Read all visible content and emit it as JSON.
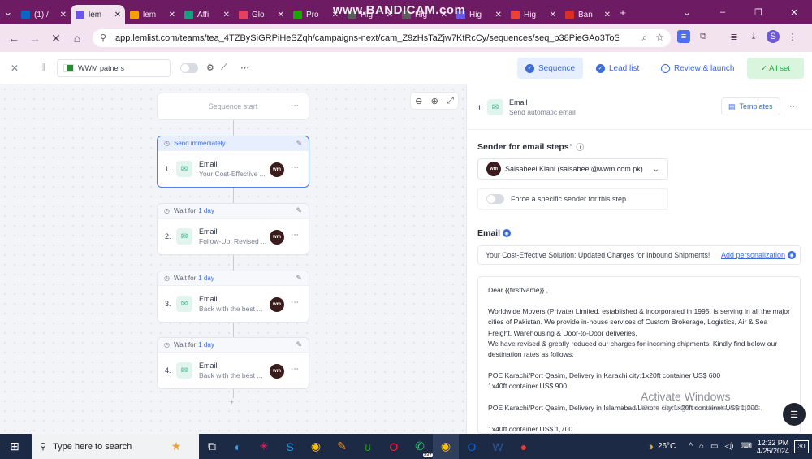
{
  "browser": {
    "tabs": [
      {
        "label": "(1) /",
        "color": "#0a66c2"
      },
      {
        "label": "lem",
        "color": "#6a56e8",
        "active": true
      },
      {
        "label": "lem",
        "color": "#f59e0b"
      },
      {
        "label": "Affi",
        "color": "#10a37f"
      },
      {
        "label": "Glo",
        "color": "#e4405f"
      },
      {
        "label": "Pro",
        "color": "#14a800"
      },
      {
        "label": "Hig",
        "color": "#5c5c5c"
      },
      {
        "label": "Hig",
        "color": "#5c5c5c"
      },
      {
        "label": "Hig",
        "color": "#6a56e8"
      },
      {
        "label": "Hig",
        "color": "#ea4335"
      },
      {
        "label": "Ban",
        "color": "#d93025"
      }
    ],
    "watermark": "www.BANDICAM.com",
    "url": "app.lemlist.com/teams/tea_4TZBySiGRPiHeSZqh/campaigns-next/cam_Z9zHsTaZjw7KtRcCy/sequences/seq_p38PieGAo3ToSMSLT/edit",
    "new_tab": "+"
  },
  "app": {
    "campaign_name": "WWM patners",
    "tabs": {
      "sequence": "Sequence",
      "lead_list": "Lead list",
      "review": "Review & launch"
    },
    "status": "✓ All set"
  },
  "canvas": {
    "start_label": "Sequence start",
    "steps": [
      {
        "num": "1.",
        "delay_prefix": "Send immediately",
        "delay_days": "",
        "type": "Email",
        "preview": "Your Cost-Effective ...",
        "selected": true
      },
      {
        "num": "2.",
        "delay_prefix": "Wait for",
        "delay_days": "1 day",
        "type": "Email",
        "preview": "Follow-Up: Revised ...",
        "selected": false
      },
      {
        "num": "3.",
        "delay_prefix": "Wait for",
        "delay_days": "1 day",
        "type": "Email",
        "preview": "Back with the best ...",
        "selected": false
      },
      {
        "num": "4.",
        "delay_prefix": "Wait for",
        "delay_days": "1 day",
        "type": "Email",
        "preview": "Back with the best ...",
        "selected": false
      }
    ],
    "avatar_text": "wm"
  },
  "panel": {
    "step_num": "1.",
    "step_title": "Email",
    "step_subtitle": "Send automatic email",
    "templates_label": "Templates",
    "sender_label": "Sender for email steps",
    "sender_value": "Salsabeel Kiani (salsabeel@wwm.com.pk)",
    "force_label": "Force a specific sender for this step",
    "email_label": "Email",
    "subject": "Your Cost-Effective Solution: Updated Charges for Inbound Shipments!",
    "add_personalization": "Add personalization",
    "body": [
      "Dear {{firstName}} ,",
      "",
      "Worldwide Movers (Private) Limited, established & incorporated in 1995, is serving in all the major cities of Pakistan. We provide in-house services of Custom Brokerage, Logistics, Air & Sea Freight, Warehousing & Door-to-Door deliveries.",
      "We have revised & greatly reduced our charges for incoming shipments. Kindly find below our destination rates as follows:",
      "",
      "POE Karachi/Port Qasim, Delivery in Karachi city:1x20ft container US$ 600",
      "1x40ft container US$ 900",
      "",
      "POE Karachi/Port Qasim, Delivery in Islamabad/Lahore city:1x20ft container US$ 1,200",
      "",
      "1x40ft container US$ 1,700"
    ]
  },
  "os": {
    "activate_title": "Activate Windows",
    "activate_sub": "Go to Settings to activate Windows.",
    "search_placeholder": "Type here to search",
    "weather": "26°C",
    "time": "12:32 PM",
    "date": "4/25/2024",
    "notif_count": "30",
    "whatsapp_badge": "99+"
  }
}
